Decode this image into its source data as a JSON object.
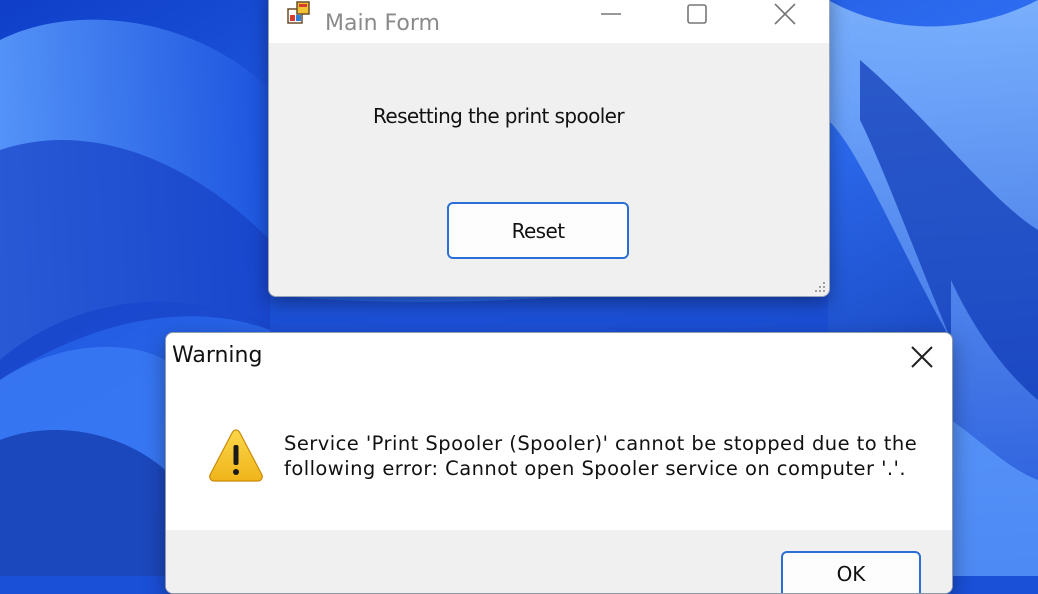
{
  "main_form": {
    "title": "Main Form",
    "label": "Resetting the print spooler",
    "reset_button_label": "Reset",
    "controls": [
      "minimize-icon",
      "maximize-icon",
      "close-icon"
    ]
  },
  "warning_dialog": {
    "title": "Warning",
    "icon": "warning-icon",
    "message_line1": "Service 'Print Spooler (Spooler)' cannot be stopped due to the",
    "message_line2": "following error: Cannot open Spooler service on computer '.'.",
    "ok_button_label": "OK"
  },
  "colors": {
    "accent": "#2b6fd6",
    "wallpaper": "#1a4fd8",
    "warning_yellow": "#f7c325"
  }
}
